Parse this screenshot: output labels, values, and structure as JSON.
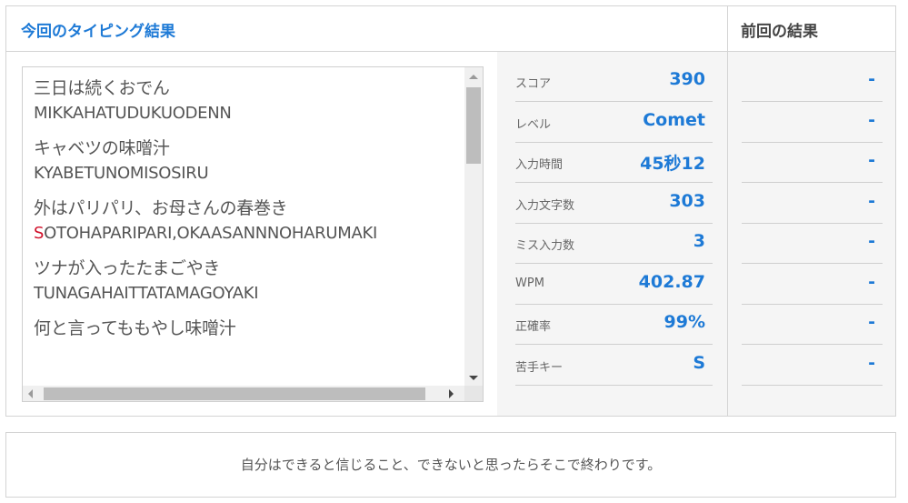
{
  "header": {
    "current_title": "今回のタイピング結果",
    "previous_title": "前回の結果"
  },
  "typed_text": [
    {
      "japanese": "三日は続くおでん",
      "romaji": "MIKKAHATUDUKUODENN",
      "miss_prefix": "",
      "romaji_rest": "MIKKAHATUDUKUODENN"
    },
    {
      "japanese": "キャベツの味噌汁",
      "romaji": "KYABETUNOMISOSIRU",
      "miss_prefix": "",
      "romaji_rest": "KYABETUNOMISOSIRU"
    },
    {
      "japanese": "外はパリパリ、お母さんの春巻き",
      "romaji": "SOTOHAPARIPARI,OKAASANNNOHARUMAKI",
      "miss_prefix": "S",
      "romaji_rest": "OTOHAPARIPARI,OKAASANNNOHARUMAKI"
    },
    {
      "japanese": "ツナが入ったたまごやき",
      "romaji": "TUNAGAHAITTATAMAGOYAKI",
      "miss_prefix": "",
      "romaji_rest": "TUNAGAHAITTATAMAGOYAKI"
    },
    {
      "japanese": "何と言ってももやし味噌汁",
      "romaji": "",
      "miss_prefix": "",
      "romaji_rest": ""
    }
  ],
  "stats": [
    {
      "label": "スコア",
      "value": "390"
    },
    {
      "label": "レベル",
      "value": "Comet"
    },
    {
      "label": "入力時間",
      "value": "45秒12"
    },
    {
      "label": "入力文字数",
      "value": "303"
    },
    {
      "label": "ミス入力数",
      "value": "3"
    },
    {
      "label": "WPM",
      "value": "402.87"
    },
    {
      "label": "正確率",
      "value": "99%"
    },
    {
      "label": "苦手キー",
      "value": "S"
    }
  ],
  "previous": [
    "-",
    "-",
    "-",
    "-",
    "-",
    "-",
    "-",
    "-"
  ],
  "quote": "自分はできると信じること、できないと思ったらそこで終わりです。",
  "colors": {
    "accent": "#1e7ad6",
    "miss": "#d0102a",
    "panel_bg": "#f5f5f5",
    "border": "#d4d4d4"
  }
}
